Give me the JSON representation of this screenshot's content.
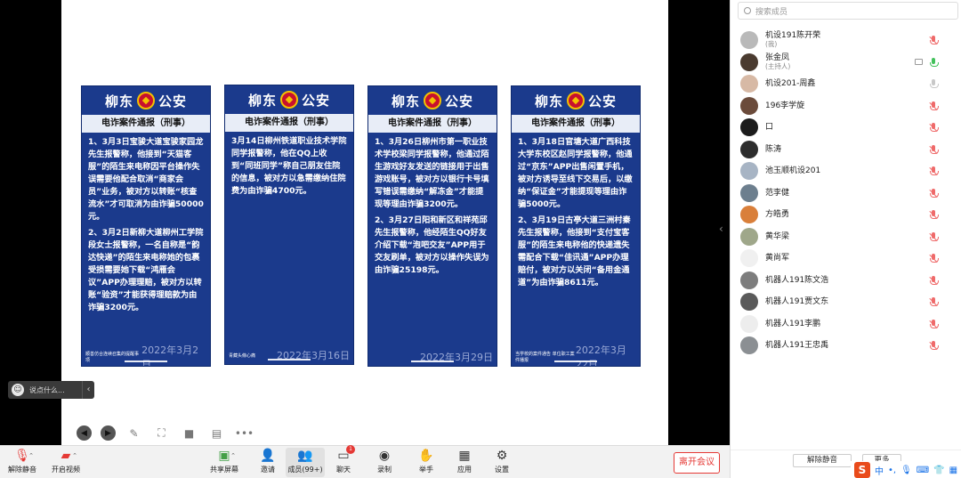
{
  "colors": {
    "card_blue": "#1b3a8c",
    "leave_red": "#e53935",
    "muted_red": "#ef6a6a",
    "active_green": "#43c15b"
  },
  "cards": [
    {
      "header_left": "柳东",
      "header_right": "公安",
      "subtitle": "电诈案件通报（刑事）",
      "paragraphs": [
        "1、3月3日宝骏大道宝骏家园龙先生报警称，他接到“天猫客服”的陌生来电称因平台操作失误需要他配合取消“商家会员”业务，被对方以转账“核查流水”才可取消为由诈骗50000元。",
        "2、3月2日新柳大道柳州工学院段女士报警称，一名自称是“韵达快递”的陌生来电称她的包裹受损需要她下载“鸿雁会议”APP办理理赔，被对方以转账“验资”才能获得理赔款为由诈骗3200元。"
      ],
      "source": "顺善仿合连续召集的提醒事项",
      "date": "2022年3月2日"
    },
    {
      "header_left": "柳东",
      "header_right": "公安",
      "subtitle": "电诈案件通报（刑事）",
      "paragraphs": [
        "3月14日柳州铁道职业技术学院同学报警称，他在QQ上收到“同班同学”称自己朋友住院的信息，被对方以急需缴纳住院费为由诈骗4700元。"
      ],
      "source": "青藏头條心痛",
      "date": "2022年3月16日"
    },
    {
      "header_left": "柳东",
      "header_right": "公安",
      "subtitle": "电诈案件通报（刑事）",
      "paragraphs": [
        "1、3月26日柳州市第一职业技术学校梁同学报警称，他通过陌生游戏好友发送的链接用于出售游戏账号，被对方以银行卡号填写错误需缴纳“解冻金”才能提现等理由诈骗3200元。",
        "2、3月27日阳和新区和祥苑邱先生报警称，他经陌生QQ好友介绍下载“泡吧交友”APP用于交友刷单，被对方以操作失误为由诈骗25198元。"
      ],
      "source": "",
      "date": "2022年3月29日"
    },
    {
      "header_left": "柳东",
      "header_right": "公安",
      "subtitle": "电诈案件通报（刑事）",
      "paragraphs": [
        "1、3月18日官塘大道广西科技大学东校区赵同学报警称，他通过“京东”APP出售闲置手机，被对方诱导至线下交易后，以缴纳“保证金”才能提现等理由诈骗5000元。",
        "2、3月19日古亭大道三洲村秦先生报警称，他接到“支付宝客服”的陌生来电称他的快递遗失需配合下载“佳讯通”APP办理赔付，被对方以关闭“备用金通道”为由诈骗8611元。"
      ],
      "source": "当学校的案件通告 单位职工案件播报",
      "date": "2022年3月22日"
    }
  ],
  "chat_hint": {
    "placeholder": "说点什么..."
  },
  "toolbar": {
    "unmute": "解除静音",
    "video": "开启视频",
    "share": "共享屏幕",
    "invite": "邀请",
    "members": "成员(99+)",
    "chat": "聊天",
    "chat_badge": "1",
    "record": "录制",
    "raise_hand": "举手",
    "apps": "应用",
    "settings": "设置",
    "leave": "离开会议"
  },
  "panel": {
    "search_placeholder": "搜索成员",
    "members": [
      {
        "name": "机设191陈开荣",
        "tag": "(我)",
        "mic": "muted",
        "avatar": "#b9b9b9"
      },
      {
        "name": "张金凤",
        "tag": "(主持人)",
        "mic": "on",
        "avatar": "#4a3b30",
        "screen": true
      },
      {
        "name": "机设201-周鑫",
        "tag": "",
        "mic": "idle",
        "avatar": "#d7b9a5"
      },
      {
        "name": "196李学旋",
        "tag": "",
        "mic": "muted",
        "avatar": "#6b4b3b"
      },
      {
        "name": "口",
        "tag": "",
        "mic": "muted",
        "avatar": "#1c1c1c"
      },
      {
        "name": "陈涛",
        "tag": "",
        "mic": "muted",
        "avatar": "#2d2d2d"
      },
      {
        "name": "池玉顺机设201",
        "tag": "",
        "mic": "muted",
        "avatar": "#a7b4c4"
      },
      {
        "name": "范李健",
        "tag": "",
        "mic": "muted",
        "avatar": "#6d7f8e"
      },
      {
        "name": "方皓勇",
        "tag": "",
        "mic": "muted",
        "avatar": "#d97f3a"
      },
      {
        "name": "黄华梁",
        "tag": "",
        "mic": "muted",
        "avatar": "#9fa78a"
      },
      {
        "name": "黄尚军",
        "tag": "",
        "mic": "muted",
        "avatar": "#f0f0f0"
      },
      {
        "name": "机器人191陈文浩",
        "tag": "",
        "mic": "muted",
        "avatar": "#7d7d7d"
      },
      {
        "name": "机器人191贾文东",
        "tag": "",
        "mic": "muted",
        "avatar": "#5a5a5a"
      },
      {
        "name": "机器人191李鹏",
        "tag": "",
        "mic": "muted",
        "avatar": "#ededed"
      },
      {
        "name": "机器人191王忠禹",
        "tag": "",
        "mic": "muted",
        "avatar": "#8b8f93"
      }
    ],
    "unmute_all": "解除静音",
    "more": "更多"
  },
  "ime": {
    "logo": "S",
    "lang": "中"
  }
}
